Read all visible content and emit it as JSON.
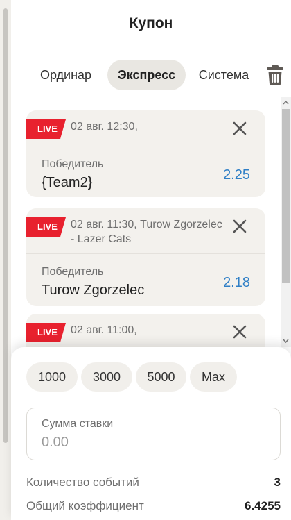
{
  "header": {
    "title": "Купон"
  },
  "tabs": [
    {
      "label": "Ординар",
      "active": false
    },
    {
      "label": "Экспресс",
      "active": true
    },
    {
      "label": "Система",
      "active": false
    }
  ],
  "icons": {
    "delete": "trash-icon",
    "remove": "close-icon",
    "scroll_up": "chevron-up-icon",
    "scroll_down": "chevron-down-icon"
  },
  "colors": {
    "live": "#e8212e",
    "odds": "#2f7fc6",
    "active_tab": "#e9e7e2"
  },
  "bets": [
    {
      "badge": "LIVE",
      "datetime": "02 авг. 12:30,",
      "market": "Победитель",
      "pick": "{Team2}",
      "odds": "2.25"
    },
    {
      "badge": "LIVE",
      "datetime": "02 авг. 11:30, Turow Zgorzelec - Lazer Cats",
      "market": "Победитель",
      "pick": "Turow Zgorzelec",
      "odds": "2.18"
    },
    {
      "badge": "LIVE",
      "datetime": "02 авг. 11:00,"
    }
  ],
  "quick_amounts": [
    "1000",
    "3000",
    "5000",
    "Max"
  ],
  "stake": {
    "label": "Сумма ставки",
    "placeholder": "0.00"
  },
  "summary": {
    "events_label": "Количество событий",
    "events_value": "3",
    "total_odds_label": "Общий коэффициент",
    "total_odds_value": "6.4255"
  }
}
